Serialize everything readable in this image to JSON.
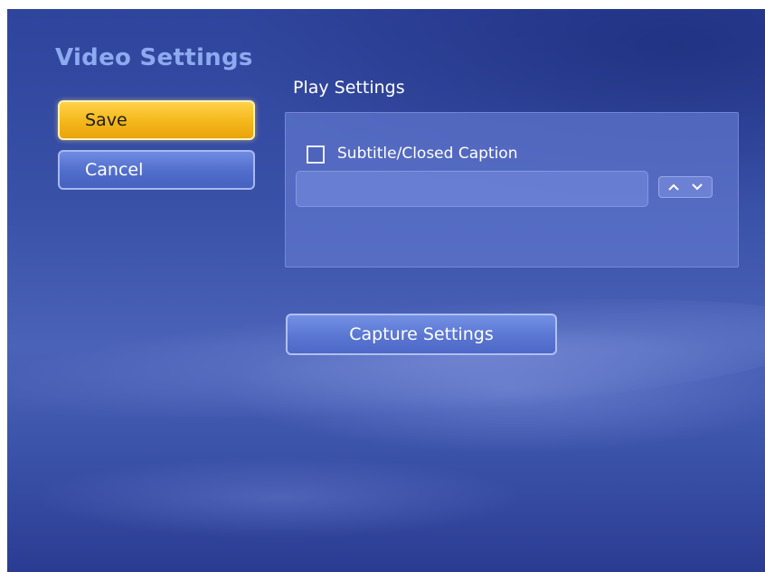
{
  "page": {
    "title": "Video Settings"
  },
  "menu": {
    "save_label": "Save",
    "cancel_label": "Cancel"
  },
  "play_settings": {
    "section_title": "Play Settings",
    "subtitle_checkbox_label": "Subtitle/Closed Caption",
    "subtitle_checked": false,
    "caption_field_value": "",
    "spinner_icons": [
      "chevron-up-icon",
      "chevron-down-icon"
    ]
  },
  "capture": {
    "button_label": "Capture Settings"
  },
  "colors": {
    "accent_selected": "#f4b71a",
    "button_blue": "#516dcb",
    "title_blue": "#8fa9f0",
    "background_blue": "#3a51a8"
  }
}
